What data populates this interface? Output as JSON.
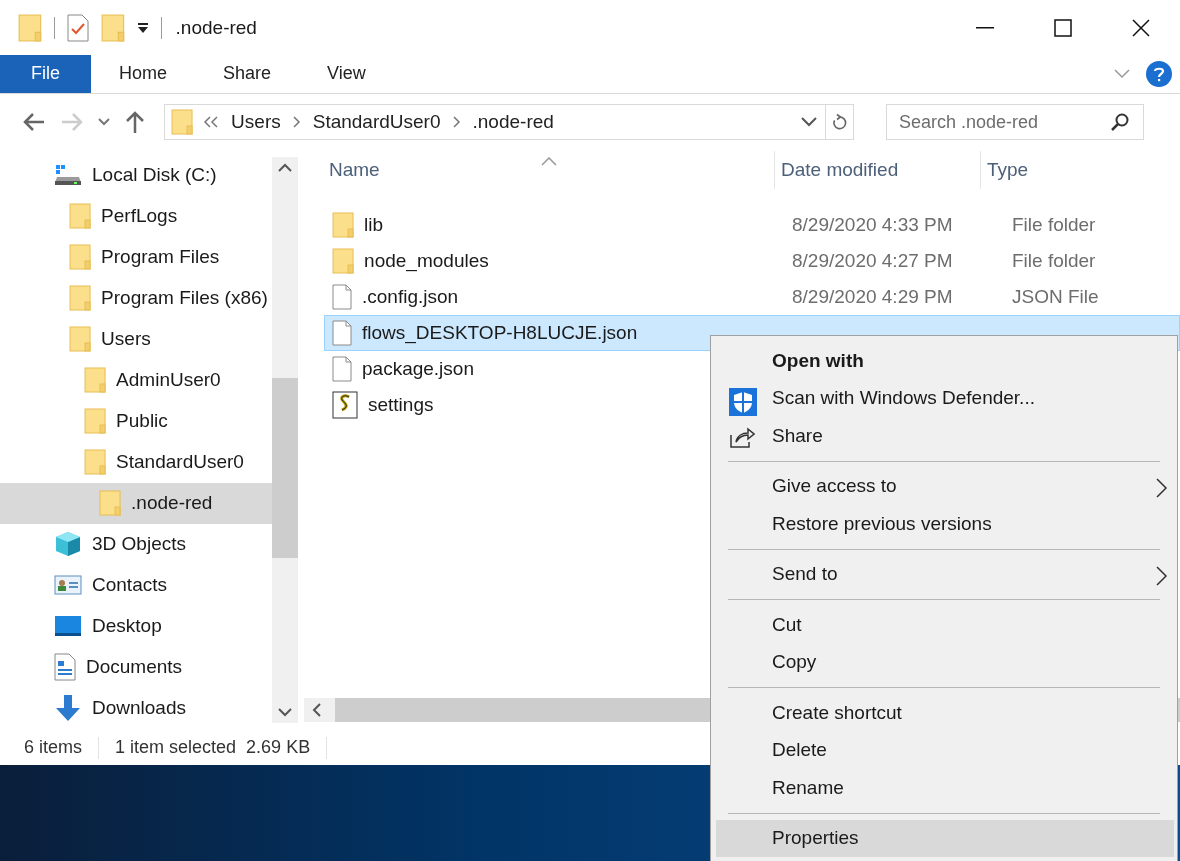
{
  "window": {
    "title": ".node-red"
  },
  "ribbon": {
    "tabs": [
      {
        "label": "File",
        "kind": "file"
      },
      {
        "label": "Home",
        "kind": "tab"
      },
      {
        "label": "Share",
        "kind": "tab"
      },
      {
        "label": "View",
        "kind": "tab"
      }
    ]
  },
  "address_bar": {
    "path": [
      "Users",
      "StandardUser0",
      ".node-red"
    ]
  },
  "search": {
    "placeholder": "Search .node-red"
  },
  "sidebar": {
    "items": [
      {
        "label": "Local Disk (C:)",
        "kind": "drive",
        "selected": false,
        "children": [
          {
            "label": "PerfLogs",
            "kind": "folder",
            "selected": false
          },
          {
            "label": "Program Files",
            "kind": "folder",
            "selected": false
          },
          {
            "label": "Program Files (x86)",
            "kind": "folder",
            "selected": false
          },
          {
            "label": "Users",
            "kind": "folder",
            "selected": false,
            "children": [
              {
                "label": "AdminUser0",
                "kind": "folder",
                "selected": false
              },
              {
                "label": "Public",
                "kind": "folder",
                "selected": false
              },
              {
                "label": "StandardUser0",
                "kind": "folder",
                "selected": false,
                "children": [
                  {
                    "label": ".node-red",
                    "kind": "folder",
                    "selected": true
                  }
                ]
              }
            ]
          }
        ]
      },
      {
        "label": "3D Objects",
        "kind": "objects",
        "selected": false
      },
      {
        "label": "Contacts",
        "kind": "contacts",
        "selected": false
      },
      {
        "label": "Desktop",
        "kind": "desktop",
        "selected": false
      },
      {
        "label": "Documents",
        "kind": "documents",
        "selected": false
      },
      {
        "label": "Downloads",
        "kind": "downloads",
        "selected": false
      }
    ]
  },
  "file_list": {
    "columns": [
      "Name",
      "Date modified",
      "Type"
    ],
    "rows": [
      {
        "name": "lib",
        "kind": "folder",
        "date": "8/29/2020 4:33 PM",
        "type": "File folder",
        "selected": false
      },
      {
        "name": "node_modules",
        "kind": "folder",
        "date": "8/29/2020 4:27 PM",
        "type": "File folder",
        "selected": false
      },
      {
        "name": ".config.json",
        "kind": "file",
        "date": "8/29/2020 4:29 PM",
        "type": "JSON File",
        "selected": false
      },
      {
        "name": "flows_DESKTOP-H8LUCJE.json",
        "kind": "file",
        "selected": true
      },
      {
        "name": "package.json",
        "kind": "file",
        "selected": false
      },
      {
        "name": "settings",
        "kind": "script",
        "selected": false
      }
    ]
  },
  "status_bar": {
    "count": "6 items",
    "selection": "1 item selected",
    "size": "2.69 KB"
  },
  "context_menu": {
    "groups": [
      [
        {
          "label": "Open with",
          "kind": "default",
          "selected": false
        },
        {
          "label": "Scan with Windows Defender...",
          "kind": "scan",
          "selected": false
        },
        {
          "label": "Share",
          "kind": "share",
          "selected": false
        }
      ],
      [
        {
          "label": "Give access to",
          "kind": "submenu",
          "selected": false
        },
        {
          "label": "Restore previous versions",
          "kind": "plain",
          "selected": false
        }
      ],
      [
        {
          "label": "Send to",
          "kind": "submenu",
          "selected": false
        }
      ],
      [
        {
          "label": "Cut",
          "kind": "plain",
          "selected": false
        },
        {
          "label": "Copy",
          "kind": "plain",
          "selected": false
        }
      ],
      [
        {
          "label": "Create shortcut",
          "kind": "plain",
          "selected": false
        },
        {
          "label": "Delete",
          "kind": "plain",
          "selected": false
        },
        {
          "label": "Rename",
          "kind": "plain",
          "selected": false
        }
      ],
      [
        {
          "label": "Properties",
          "kind": "plain",
          "selected": true
        }
      ]
    ]
  }
}
